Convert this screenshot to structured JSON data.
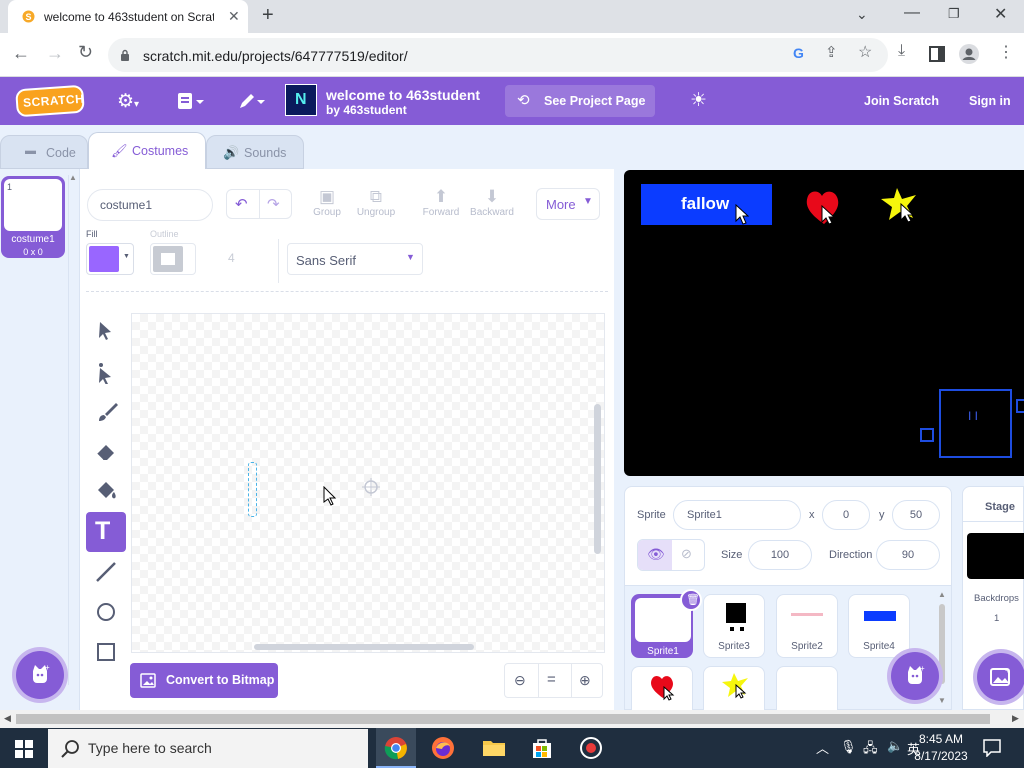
{
  "browser": {
    "tab_title": "welcome to 463student on Scrat",
    "url": "scratch.mit.edu/projects/647777519/editor/"
  },
  "menubar": {
    "logo": "SCRATCH",
    "project_title": "welcome to 463student",
    "project_author": "by 463student",
    "see_project_page": "See Project Page",
    "join": "Join Scratch",
    "signin": "Sign in"
  },
  "tabs": [
    {
      "label": "Code"
    },
    {
      "label": "Costumes"
    },
    {
      "label": "Sounds"
    }
  ],
  "costume": {
    "number": "1",
    "name": "costume1",
    "size": "0 x 0"
  },
  "paint": {
    "costume_name": "costume1",
    "group": "Group",
    "ungroup": "Ungroup",
    "forward": "Forward",
    "backward": "Backward",
    "more": "More",
    "fill_label": "Fill",
    "outline_label": "Outline",
    "outline_width": "4",
    "font": "Sans Serif",
    "convert": "Convert to Bitmap",
    "fill_color": "#9966ff"
  },
  "stage": {
    "button_text": "fallow",
    "key_text": "I I"
  },
  "sprite_info": {
    "sprite_label": "Sprite",
    "sprite_name": "Sprite1",
    "x_label": "x",
    "x": "0",
    "y_label": "y",
    "y": "50",
    "size_label": "Size",
    "size": "100",
    "direction_label": "Direction",
    "direction": "90"
  },
  "sprites": [
    {
      "name": "Sprite1"
    },
    {
      "name": "Sprite3"
    },
    {
      "name": "Sprite2"
    },
    {
      "name": "Sprite4"
    }
  ],
  "stage_panel": {
    "title": "Stage",
    "backdrops_label": "Backdrops",
    "backdrops_count": "1"
  },
  "taskbar": {
    "search_placeholder": "Type here to search",
    "time": "8:45 AM",
    "date": "8/17/2023"
  },
  "colors": {
    "scratch_purple": "#855cd6",
    "stage_button_blue": "#0b3cff"
  }
}
